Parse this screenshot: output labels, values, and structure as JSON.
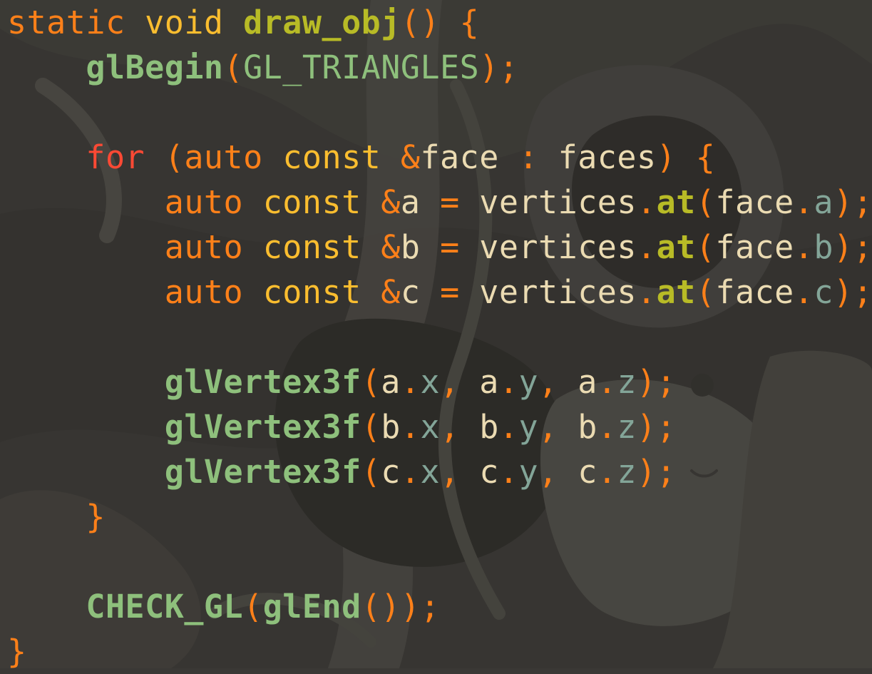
{
  "theme": {
    "background": "#3a3835",
    "colors": {
      "plain": "#ebdbb2",
      "keyword": "#fe8019",
      "type": "#fabd2f",
      "control": "#fb4934",
      "function": "#8ec07c",
      "member_fn": "#b8bb26",
      "member": "#83a598",
      "punct": "#fe8019",
      "constant": "#8ec07c"
    }
  },
  "code_lines": [
    [
      [
        "static ",
        "keyword"
      ],
      [
        "void ",
        "type"
      ],
      [
        "draw_obj",
        "member_fn"
      ],
      [
        "() {",
        "punct"
      ]
    ],
    [
      [
        "    ",
        "plain"
      ],
      [
        "glBegin",
        "function"
      ],
      [
        "(",
        "punct"
      ],
      [
        "GL_TRIANGLES",
        "constant"
      ],
      [
        ");",
        "punct"
      ]
    ],
    [],
    [
      [
        "    ",
        "plain"
      ],
      [
        "for ",
        "control"
      ],
      [
        "(",
        "punct"
      ],
      [
        "auto ",
        "keyword"
      ],
      [
        "const ",
        "type"
      ],
      [
        "&",
        "punct"
      ],
      [
        "face ",
        "plain"
      ],
      [
        ": ",
        "punct"
      ],
      [
        "faces",
        "plain"
      ],
      [
        ") {",
        "punct"
      ]
    ],
    [
      [
        "        ",
        "plain"
      ],
      [
        "auto ",
        "keyword"
      ],
      [
        "const ",
        "type"
      ],
      [
        "&",
        "punct"
      ],
      [
        "a ",
        "plain"
      ],
      [
        "= ",
        "punct"
      ],
      [
        "vertices",
        "plain"
      ],
      [
        ".",
        "punct"
      ],
      [
        "at",
        "member_fn"
      ],
      [
        "(",
        "punct"
      ],
      [
        "face",
        "plain"
      ],
      [
        ".",
        "punct"
      ],
      [
        "a",
        "member"
      ],
      [
        ");",
        "punct"
      ]
    ],
    [
      [
        "        ",
        "plain"
      ],
      [
        "auto ",
        "keyword"
      ],
      [
        "const ",
        "type"
      ],
      [
        "&",
        "punct"
      ],
      [
        "b ",
        "plain"
      ],
      [
        "= ",
        "punct"
      ],
      [
        "vertices",
        "plain"
      ],
      [
        ".",
        "punct"
      ],
      [
        "at",
        "member_fn"
      ],
      [
        "(",
        "punct"
      ],
      [
        "face",
        "plain"
      ],
      [
        ".",
        "punct"
      ],
      [
        "b",
        "member"
      ],
      [
        ");",
        "punct"
      ]
    ],
    [
      [
        "        ",
        "plain"
      ],
      [
        "auto ",
        "keyword"
      ],
      [
        "const ",
        "type"
      ],
      [
        "&",
        "punct"
      ],
      [
        "c ",
        "plain"
      ],
      [
        "= ",
        "punct"
      ],
      [
        "vertices",
        "plain"
      ],
      [
        ".",
        "punct"
      ],
      [
        "at",
        "member_fn"
      ],
      [
        "(",
        "punct"
      ],
      [
        "face",
        "plain"
      ],
      [
        ".",
        "punct"
      ],
      [
        "c",
        "member"
      ],
      [
        ");",
        "punct"
      ]
    ],
    [],
    [
      [
        "        ",
        "plain"
      ],
      [
        "glVertex3f",
        "function"
      ],
      [
        "(",
        "punct"
      ],
      [
        "a",
        "plain"
      ],
      [
        ".",
        "punct"
      ],
      [
        "x",
        "member"
      ],
      [
        ", ",
        "punct"
      ],
      [
        "a",
        "plain"
      ],
      [
        ".",
        "punct"
      ],
      [
        "y",
        "member"
      ],
      [
        ", ",
        "punct"
      ],
      [
        "a",
        "plain"
      ],
      [
        ".",
        "punct"
      ],
      [
        "z",
        "member"
      ],
      [
        ");",
        "punct"
      ]
    ],
    [
      [
        "        ",
        "plain"
      ],
      [
        "glVertex3f",
        "function"
      ],
      [
        "(",
        "punct"
      ],
      [
        "b",
        "plain"
      ],
      [
        ".",
        "punct"
      ],
      [
        "x",
        "member"
      ],
      [
        ", ",
        "punct"
      ],
      [
        "b",
        "plain"
      ],
      [
        ".",
        "punct"
      ],
      [
        "y",
        "member"
      ],
      [
        ", ",
        "punct"
      ],
      [
        "b",
        "plain"
      ],
      [
        ".",
        "punct"
      ],
      [
        "z",
        "member"
      ],
      [
        ");",
        "punct"
      ]
    ],
    [
      [
        "        ",
        "plain"
      ],
      [
        "glVertex3f",
        "function"
      ],
      [
        "(",
        "punct"
      ],
      [
        "c",
        "plain"
      ],
      [
        ".",
        "punct"
      ],
      [
        "x",
        "member"
      ],
      [
        ", ",
        "punct"
      ],
      [
        "c",
        "plain"
      ],
      [
        ".",
        "punct"
      ],
      [
        "y",
        "member"
      ],
      [
        ", ",
        "punct"
      ],
      [
        "c",
        "plain"
      ],
      [
        ".",
        "punct"
      ],
      [
        "z",
        "member"
      ],
      [
        ");",
        "punct"
      ]
    ],
    [
      [
        "    ",
        "plain"
      ],
      [
        "}",
        "punct"
      ]
    ],
    [],
    [
      [
        "    ",
        "plain"
      ],
      [
        "CHECK_GL",
        "function"
      ],
      [
        "(",
        "punct"
      ],
      [
        "glEnd",
        "function"
      ],
      [
        "());",
        "punct"
      ]
    ],
    [
      [
        "}",
        "punct"
      ]
    ]
  ]
}
